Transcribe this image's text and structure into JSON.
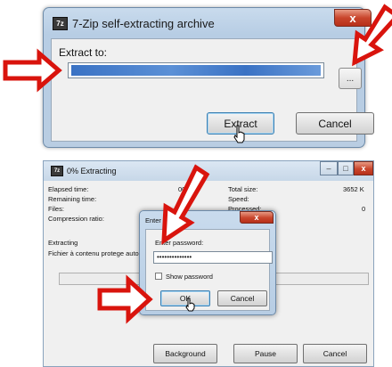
{
  "extract_window": {
    "title": "7-Zip self-extracting archive",
    "icon_text": "7z",
    "extract_to_label": "Extract to:",
    "path_value": "",
    "browse_label": "...",
    "extract_label": "Extract",
    "cancel_label": "Cancel",
    "close_glyph": "x"
  },
  "progress_window": {
    "title": "0% Extracting",
    "icon_text": "7z",
    "elapsed_label": "Elapsed time:",
    "elapsed_value": "00:0",
    "remaining_label": "Remaining time:",
    "files_label": "Files:",
    "compression_label": "Compression ratio:",
    "total_size_label": "Total size:",
    "total_size_value": "3652 K",
    "speed_label": "Speed:",
    "processed_label": "Processed:",
    "processed_value": "0",
    "status_text": "Extracting",
    "file_text": "Fichier à contenu protege auto",
    "background_label": "Background",
    "pause_label": "Pause",
    "cancel_label": "Cancel",
    "progress": 0
  },
  "password_dialog": {
    "title": "Enter p",
    "prompt": "Enter password:",
    "password_value": "••••••••••••••",
    "show_password_label": "Show password",
    "ok_label": "OK",
    "cancel_label": "Cancel",
    "close_glyph": "x"
  },
  "colors": {
    "annotation_arrow": "#d9140d",
    "selection": "#3a72c4"
  }
}
